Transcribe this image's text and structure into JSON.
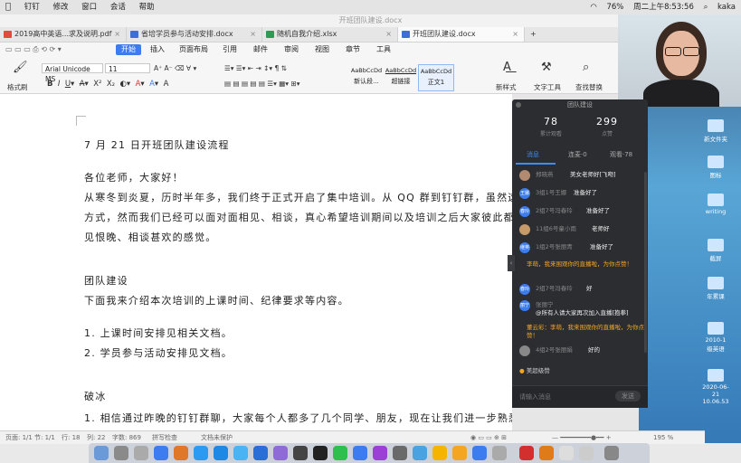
{
  "menubar": {
    "items": [
      "钉钉",
      "修改",
      "窗口",
      "会话",
      "帮助"
    ],
    "battery": "76%",
    "datetime": "周二上午8:53:56",
    "user": "kaka"
  },
  "window": {
    "title": "开班团队建设.docx"
  },
  "tabs": [
    {
      "label": "2019高中英语...求及说明.pdf",
      "color": "#e04b3a"
    },
    {
      "label": "省培学员参与活动安排.docx",
      "color": "#3c6fd8"
    },
    {
      "label": "随机自我介绍.xlsx",
      "color": "#2e9b55"
    },
    {
      "label": "开班团队建设.docx",
      "color": "#3c6fd8"
    }
  ],
  "menus": [
    "开始",
    "插入",
    "页面布局",
    "引用",
    "邮件",
    "审阅",
    "视图",
    "章节",
    "工具"
  ],
  "ribbon": {
    "format_painter": "格式刷",
    "font": "Arial Unicode MS",
    "size": "11",
    "styles": [
      {
        "preview": "AaBbCcDd",
        "label": "新认段..."
      },
      {
        "preview": "AaBbCcDd",
        "label": "超链接"
      },
      {
        "preview": "AaBbCcDd",
        "label": "正文1"
      }
    ],
    "new_style": "新样式",
    "text_tools": "文字工具",
    "find_replace": "查找替换"
  },
  "doc": {
    "lines": [
      "7 月 21 日开班团队建设流程",
      "各位老师，大家好！",
      "从寒冬到炎夏，历时半年多，我们终于正式开启了集中培训。从 QQ 群到钉钉群，虽然这",
      "方式，然而我们已经可以面对面相见、相谈，真心希望培训期间以及培训之后大家彼此都",
      "见恨晚、相谈甚欢的感觉。",
      "团队建设",
      "下面我来介绍本次培训的上课时间、纪律要求等内容。",
      "1.   上课时间安排见相关文档。",
      "2.   学员参与活动安排见文档。",
      "破冰",
      "1.   相信通过昨晚的钉钉群聊，大家每个人都多了几个同学、朋友，现在让我们进一步熟悉彼此。"
    ]
  },
  "status": {
    "page": "页面: 1/1",
    "section": "节: 1/1",
    "row": "行: 18",
    "col": "列: 22",
    "words": "字数: 869",
    "spell": "拼写检查",
    "protect": "文档未保护",
    "zoom": "195 %"
  },
  "live": {
    "title": "团队建设",
    "viewers": "78",
    "viewers_label": "累计观看",
    "likes": "299",
    "likes_label": "点赞",
    "tabs": [
      "消息",
      "连麦·0",
      "观看·78"
    ],
    "messages": [
      {
        "avatar": "",
        "name": "郑晓燕",
        "text": "美女老师好[飞吻]",
        "sys": false
      },
      {
        "avatar": "王娜",
        "name": "3组1号王娜",
        "text": "准备好了",
        "sys": false
      },
      {
        "avatar": "春玲",
        "name": "2组7号冯春玲",
        "text": "准备好了",
        "sys": false
      },
      {
        "avatar": "",
        "name": "11组6号童小雨",
        "text": "老师好",
        "sys": false
      },
      {
        "avatar": "继英",
        "name": "1组2号张丽青",
        "text": "准备好了",
        "sys": false
      },
      {
        "avatar": "",
        "name": "",
        "text": "李萌，我来围观你的直播啦，为你点赞！",
        "sys": true
      },
      {
        "avatar": "春玲",
        "name": "2组7号冯春玲",
        "text": "好",
        "sys": false
      },
      {
        "avatar": "丽宁",
        "name": "张丽宁",
        "text": "@所有人请大家再次加入直播[抱拳]",
        "sys": false
      },
      {
        "avatar": "",
        "name": "",
        "text": "董云彩：李萌，我来围观你的直播啦，为你点赞！",
        "sys": true
      },
      {
        "avatar": "",
        "name": "4组2号张丽娟",
        "text": "好的",
        "sys": false
      }
    ],
    "like_label": "美超级赞",
    "input_placeholder": "请输入消息",
    "send": "发送"
  },
  "desktop": {
    "icons": [
      "新文件夹",
      "图标",
      "writing",
      "截屏",
      "年累课",
      "2010-1\n级英语",
      "2020-06-21\n10.06.53"
    ]
  }
}
